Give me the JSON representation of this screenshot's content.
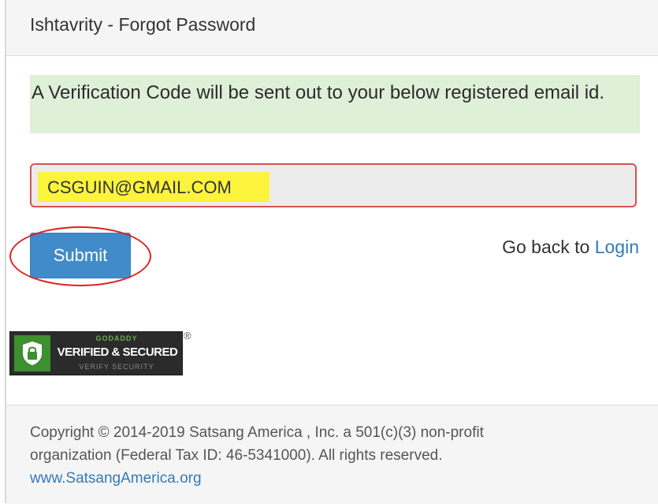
{
  "header": {
    "title": "Ishtavrity - Forgot Password"
  },
  "info": {
    "message": "A Verification Code will be sent out to your below registered email id."
  },
  "form": {
    "email_value": "CSGUIN@GMAIL.COM",
    "submit_label": "Submit",
    "go_back_text": "Go back to ",
    "login_link": "Login"
  },
  "badge": {
    "top": "GODADDY",
    "main": "VERIFIED & SECURED",
    "sub": "VERIFY SECURITY",
    "registered": "®"
  },
  "footer": {
    "line1": "Copyright © 2014-2019 Satsang America , Inc. a 501(c)(3) non-profit",
    "line2": "organization (Federal Tax ID: 46-5341000). All rights reserved.",
    "link": "www.SatsangAmerica.org"
  },
  "colors": {
    "primary": "#428bca",
    "link": "#337ab7",
    "success_bg": "#dff0d8",
    "error_border": "#d9534f",
    "highlight": "#fbf33c",
    "annotation": "#e02020"
  }
}
